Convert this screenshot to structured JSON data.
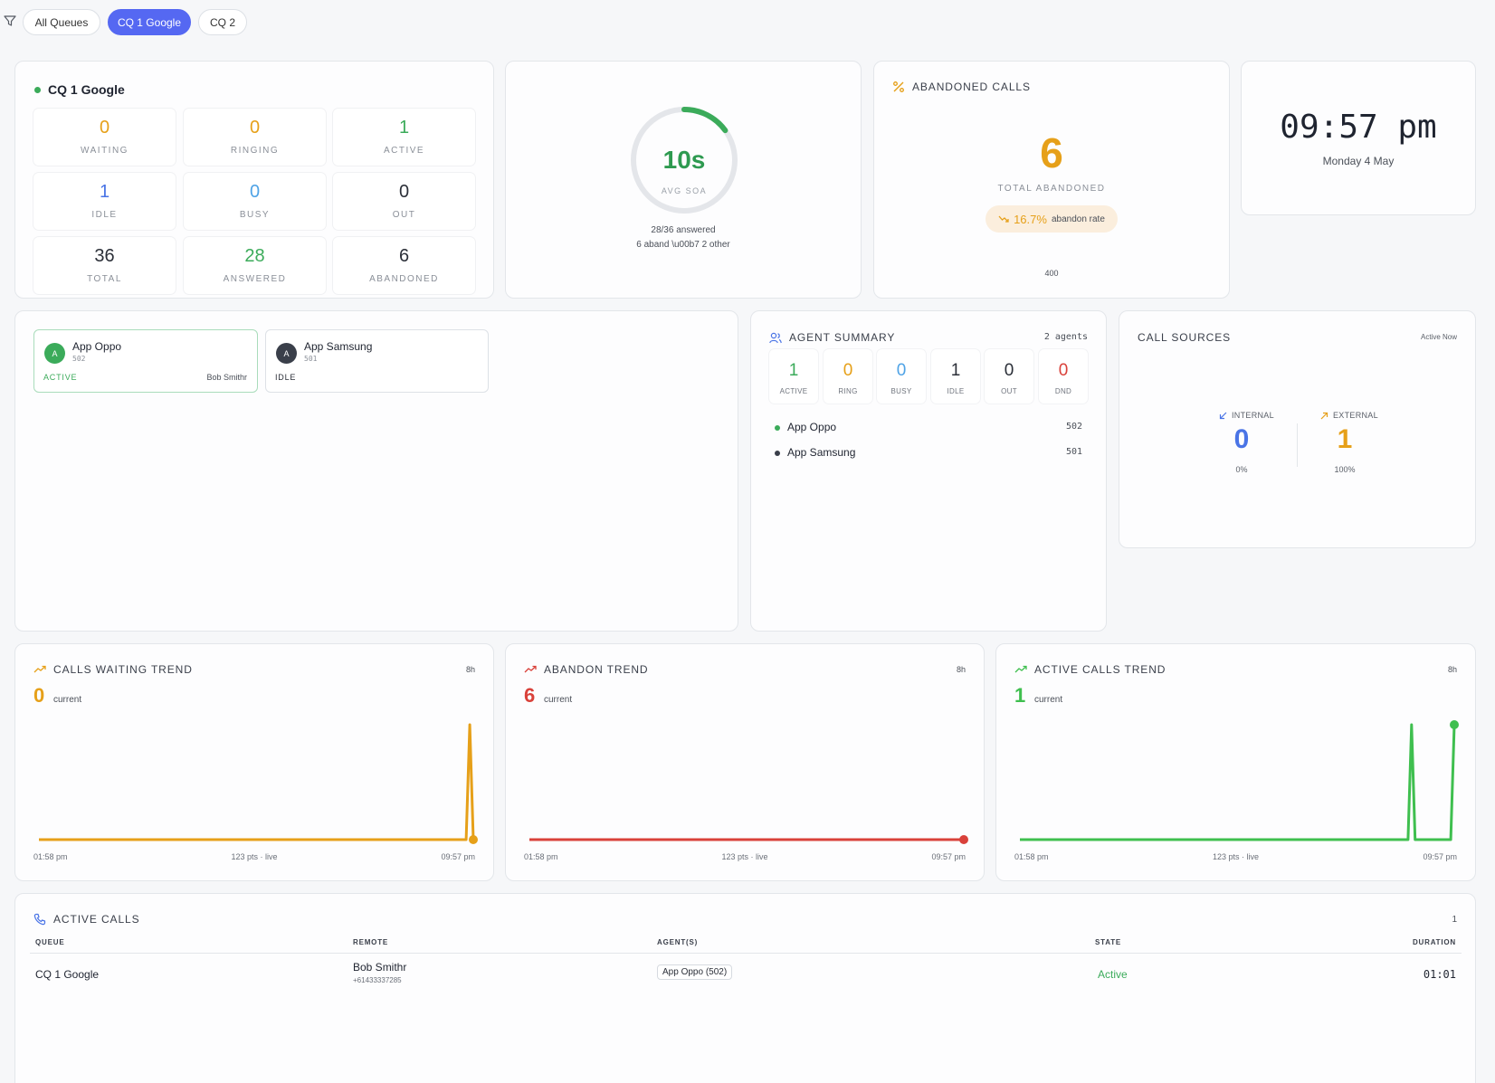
{
  "filter_tabs": [
    {
      "label": "All Queues",
      "active": false
    },
    {
      "label": "CQ 1 Google",
      "active": true
    },
    {
      "label": "CQ 2",
      "active": false
    }
  ],
  "queue": {
    "name": "CQ 1 Google",
    "stats": [
      {
        "value": "0",
        "label": "WAITING",
        "color": "#e6a019"
      },
      {
        "value": "0",
        "label": "RINGING",
        "color": "#e6a019"
      },
      {
        "value": "1",
        "label": "ACTIVE",
        "color": "#3bab5a"
      },
      {
        "value": "1",
        "label": "IDLE",
        "color": "#4a74e6"
      },
      {
        "value": "0",
        "label": "BUSY",
        "color": "#4fa3e6"
      },
      {
        "value": "0",
        "label": "OUT",
        "color": "#2b2f38"
      },
      {
        "value": "36",
        "label": "TOTAL",
        "color": "#2b2f38"
      },
      {
        "value": "28",
        "label": "ANSWERED",
        "color": "#3bab5a"
      },
      {
        "value": "6",
        "label": "ABANDONED",
        "color": "#2b2f38"
      }
    ]
  },
  "soa": {
    "value": "10s",
    "label": "AVG SOA",
    "answered_text": "28/36 answered",
    "detail_text": "6 aband \\u00b7 2 other",
    "gauge_fraction": 0.15
  },
  "abandoned": {
    "title": "ABANDONED CALLS",
    "value": "6",
    "label": "TOTAL ABANDONED",
    "rate": "16.7%",
    "rate_label": "abandon rate",
    "footer": "400"
  },
  "clock": {
    "time": "09:57 pm",
    "date": "Monday 4 May"
  },
  "agent_cards": [
    {
      "initial": "A",
      "name": "App Oppo",
      "ext": "502",
      "state": "ACTIVE",
      "caller": "Bob Smithr",
      "color": "#3bab5a"
    },
    {
      "initial": "A",
      "name": "App Samsung",
      "ext": "501",
      "state": "IDLE",
      "caller": "",
      "color": "#3a3f4a"
    }
  ],
  "agent_summary": {
    "title": "AGENT SUMMARY",
    "count": "2 agents",
    "stats": [
      {
        "value": "1",
        "label": "ACTIVE",
        "color": "#3bab5a"
      },
      {
        "value": "0",
        "label": "RING",
        "color": "#e6a019"
      },
      {
        "value": "0",
        "label": "BUSY",
        "color": "#4fa3e6"
      },
      {
        "value": "1",
        "label": "IDLE",
        "color": "#2b2f38"
      },
      {
        "value": "0",
        "label": "OUT",
        "color": "#2b2f38"
      },
      {
        "value": "0",
        "label": "DND",
        "color": "#d9413a"
      }
    ],
    "agents": [
      {
        "name": "App Oppo",
        "ext": "502",
        "dot": "#3bab5a"
      },
      {
        "name": "App Samsung",
        "ext": "501",
        "dot": "#3a3f4a"
      }
    ]
  },
  "call_sources": {
    "title": "CALL SOURCES",
    "badge": "Active Now",
    "internal": {
      "label": "INTERNAL",
      "value": "0",
      "pct": "0%"
    },
    "external": {
      "label": "EXTERNAL",
      "value": "1",
      "pct": "100%"
    }
  },
  "trends": [
    {
      "title": "CALLS WAITING TREND",
      "range": "8h",
      "current": "0",
      "current_label": "current",
      "color": "#e6a019",
      "x_start": "01:58 pm",
      "x_mid": "123 pts · live",
      "x_end": "09:57 pm"
    },
    {
      "title": "ABANDON TREND",
      "range": "8h",
      "current": "6",
      "current_label": "current",
      "color": "#d9413a",
      "x_start": "01:58 pm",
      "x_mid": "123 pts · live",
      "x_end": "09:57 pm"
    },
    {
      "title": "ACTIVE CALLS TREND",
      "range": "8h",
      "current": "1",
      "current_label": "current",
      "color": "#3fbf4f",
      "x_start": "01:58 pm",
      "x_mid": "123 pts · live",
      "x_end": "09:57 pm"
    }
  ],
  "chart_data": [
    {
      "type": "line",
      "title": "CALLS WAITING TREND",
      "points": 123,
      "x_range": [
        "01:58 pm",
        "09:57 pm"
      ],
      "y_range": [
        0,
        1
      ],
      "spikes": [
        {
          "index": 121,
          "value": 1
        }
      ],
      "last_value": 0
    },
    {
      "type": "line",
      "title": "ABANDON TREND",
      "points": 123,
      "x_range": [
        "01:58 pm",
        "09:57 pm"
      ],
      "y_range": [
        0,
        1
      ],
      "spikes": [],
      "last_value": 0
    },
    {
      "type": "line",
      "title": "ACTIVE CALLS TREND",
      "points": 123,
      "x_range": [
        "01:58 pm",
        "09:57 pm"
      ],
      "y_range": [
        0,
        1
      ],
      "spikes": [
        {
          "index": 110,
          "value": 1
        }
      ],
      "last_value": 1
    }
  ],
  "active_calls": {
    "title": "ACTIVE CALLS",
    "count": "1",
    "columns": [
      "QUEUE",
      "REMOTE",
      "AGENT(S)",
      "STATE",
      "DURATION"
    ],
    "rows": [
      {
        "queue": "CQ 1 Google",
        "remote_name": "Bob Smithr",
        "remote_number": "+61433337285",
        "agent": "App Oppo (502)",
        "state": "Active",
        "duration": "01:01"
      }
    ]
  }
}
